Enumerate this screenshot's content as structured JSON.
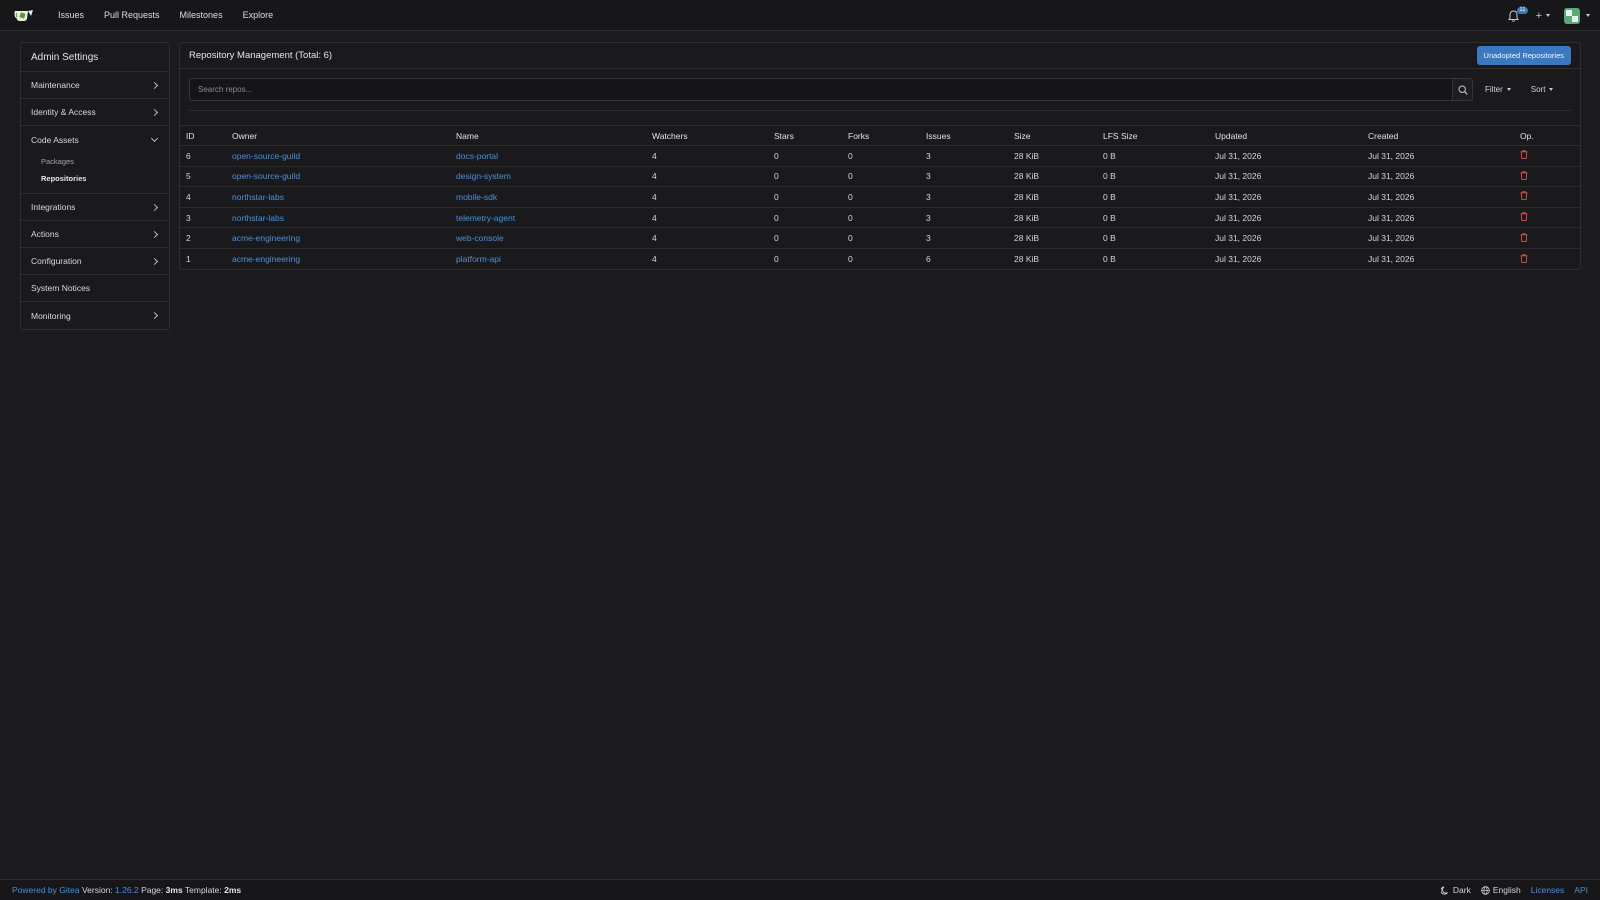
{
  "nav": {
    "items": [
      "Issues",
      "Pull Requests",
      "Milestones",
      "Explore"
    ],
    "notification_count": "11"
  },
  "sidebar": {
    "title": "Admin Settings",
    "items": [
      {
        "label": "Maintenance"
      },
      {
        "label": "Identity & Access"
      },
      {
        "label": "Code Assets",
        "sub": [
          "Packages",
          "Repositories"
        ]
      },
      {
        "label": "Integrations"
      },
      {
        "label": "Actions"
      },
      {
        "label": "Configuration"
      },
      {
        "label": "System Notices"
      },
      {
        "label": "Monitoring"
      }
    ]
  },
  "main": {
    "title": "Repository Management (Total: 6)",
    "unadopted_label": "Unadopted Repositories",
    "search_placeholder": "Search repos...",
    "filter_label": "Filter",
    "sort_label": "Sort",
    "columns": [
      "ID",
      "Owner",
      "Name",
      "Watchers",
      "Stars",
      "Forks",
      "Issues",
      "Size",
      "LFS Size",
      "Updated",
      "Created",
      "Op."
    ],
    "rows": [
      {
        "id": "6",
        "owner": "open-source-guild",
        "name": "docs-portal",
        "watchers": "4",
        "stars": "0",
        "forks": "0",
        "issues": "3",
        "size": "28 KiB",
        "lfs": "0 B",
        "updated": "Jul 31, 2026",
        "created": "Jul 31, 2026"
      },
      {
        "id": "5",
        "owner": "open-source-guild",
        "name": "design-system",
        "watchers": "4",
        "stars": "0",
        "forks": "0",
        "issues": "3",
        "size": "28 KiB",
        "lfs": "0 B",
        "updated": "Jul 31, 2026",
        "created": "Jul 31, 2026"
      },
      {
        "id": "4",
        "owner": "northstar-labs",
        "name": "mobile-sdk",
        "watchers": "4",
        "stars": "0",
        "forks": "0",
        "issues": "3",
        "size": "28 KiB",
        "lfs": "0 B",
        "updated": "Jul 31, 2026",
        "created": "Jul 31, 2026"
      },
      {
        "id": "3",
        "owner": "northstar-labs",
        "name": "telemetry-agent",
        "watchers": "4",
        "stars": "0",
        "forks": "0",
        "issues": "3",
        "size": "28 KiB",
        "lfs": "0 B",
        "updated": "Jul 31, 2026",
        "created": "Jul 31, 2026"
      },
      {
        "id": "2",
        "owner": "acme-engineering",
        "name": "web-console",
        "watchers": "4",
        "stars": "0",
        "forks": "0",
        "issues": "3",
        "size": "28 KiB",
        "lfs": "0 B",
        "updated": "Jul 31, 2026",
        "created": "Jul 31, 2026"
      },
      {
        "id": "1",
        "owner": "acme-engineering",
        "name": "platform-api",
        "watchers": "4",
        "stars": "0",
        "forks": "0",
        "issues": "6",
        "size": "28 KiB",
        "lfs": "0 B",
        "updated": "Jul 31, 2026",
        "created": "Jul 31, 2026"
      }
    ]
  },
  "footer": {
    "powered_by": "Powered by Gitea",
    "version_label": "Version:",
    "version": "1.26.2",
    "page_label": "Page:",
    "page_time": "3ms",
    "template_label": "Template:",
    "template_time": "2ms",
    "theme": "Dark",
    "language": "English",
    "licenses": "Licenses",
    "api": "API"
  },
  "colors": {
    "accent": "#3b78c2",
    "link": "#4a90d9",
    "danger": "#e05252",
    "background": "#1c1c1f"
  }
}
